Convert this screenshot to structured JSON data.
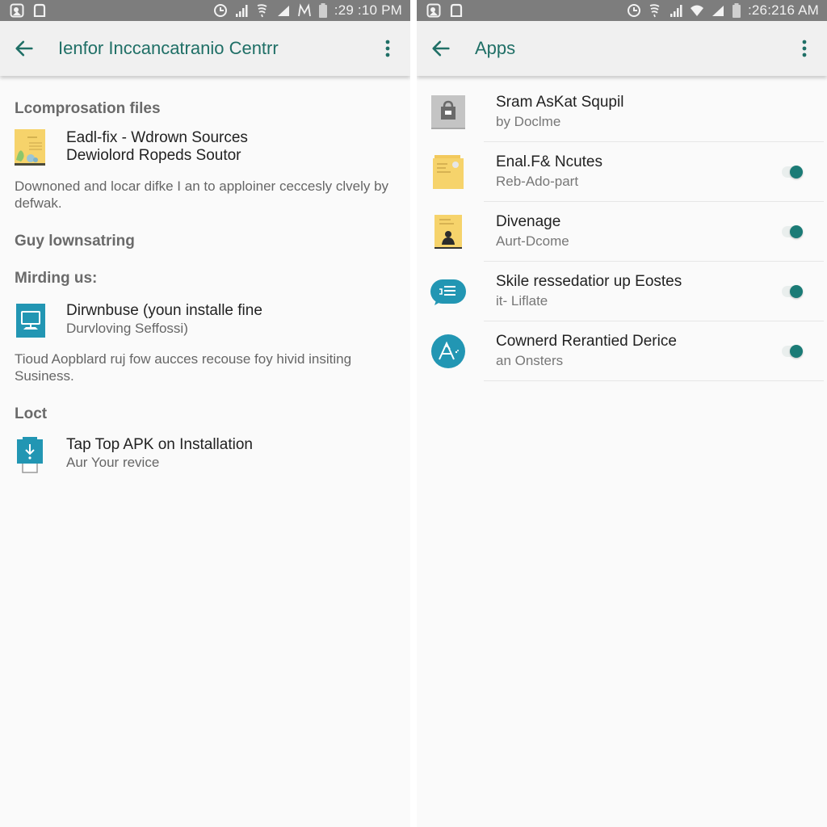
{
  "colors": {
    "accent": "#1f6f66",
    "toggle_on": "#1b7b76",
    "status_bar": "#7d7d7d",
    "app_bar": "#f0f0f0",
    "background": "#fafafa",
    "icon_yellow": "#f6d36b",
    "icon_teal": "#2296b3"
  },
  "left": {
    "status_bar": {
      "left_icons": [
        "gallery-notification-icon",
        "square-notification-icon"
      ],
      "right_icons": [
        "sync-icon",
        "signal-icon",
        "vibrate-icon",
        "signal-triangle-icon",
        "network-icon",
        "battery-icon"
      ],
      "time": ":29 :10 PM"
    },
    "app_bar": {
      "back_icon": "arrow-left-icon",
      "title": "Ienfor Inccancatranio Centrr",
      "menu_icon": "more-vert-icon"
    },
    "sections": [
      {
        "header": "Lcomprosation files",
        "item": {
          "icon": "document-illustration-icon",
          "primary": "Eadl-fix - Wdrown Sources",
          "primary2": "Dewiolord Ropeds Soutor"
        },
        "description": "Downoned and locar difke I an to apploiner ceccesly clvely by defwak."
      },
      {
        "header": "Guy lownsatring"
      },
      {
        "header": "Mirding us:",
        "item": {
          "icon": "monitor-icon",
          "primary": "Dirwnbuse (youn installe fine",
          "secondary": "Durvloving Seffossi)"
        },
        "description": "Tioud Aopblard ruj fow aucces recouse foy hivid insiting Susiness."
      },
      {
        "header": "Loct",
        "item": {
          "icon": "usb-download-icon",
          "primary": "Tap Top APK on Installation",
          "secondary": "Aur Your revice"
        }
      }
    ]
  },
  "right": {
    "status_bar": {
      "left_icons": [
        "gallery-notification-icon",
        "square-notification-icon"
      ],
      "right_icons": [
        "sync-icon",
        "vibrate-icon",
        "signal-icon",
        "wifi-icon",
        "signal-triangle-icon",
        "battery-icon"
      ],
      "time": ":26:216 AM"
    },
    "app_bar": {
      "back_icon": "arrow-left-icon",
      "title": "Apps",
      "menu_icon": "more-vert-icon"
    },
    "apps": [
      {
        "icon": "lock-bag-icon",
        "name": "Sram AsKat Squpil",
        "subtitle": "by Doclme",
        "toggle": null
      },
      {
        "icon": "yellow-folder-icon",
        "name": "Enal.F& Ncutes",
        "subtitle": "Reb-Ado-part",
        "toggle": true
      },
      {
        "icon": "yellow-contact-icon",
        "name": "Divenage",
        "subtitle": "Aurt-Dcome",
        "toggle": true
      },
      {
        "icon": "chat-list-icon",
        "name": "Skile ressedatior up Eostes",
        "subtitle": "it- Liflate",
        "toggle": true
      },
      {
        "icon": "accessibility-circle-icon",
        "name": "Cownerd Rerantied Derice",
        "subtitle": "an Onsters",
        "toggle": true
      }
    ]
  }
}
